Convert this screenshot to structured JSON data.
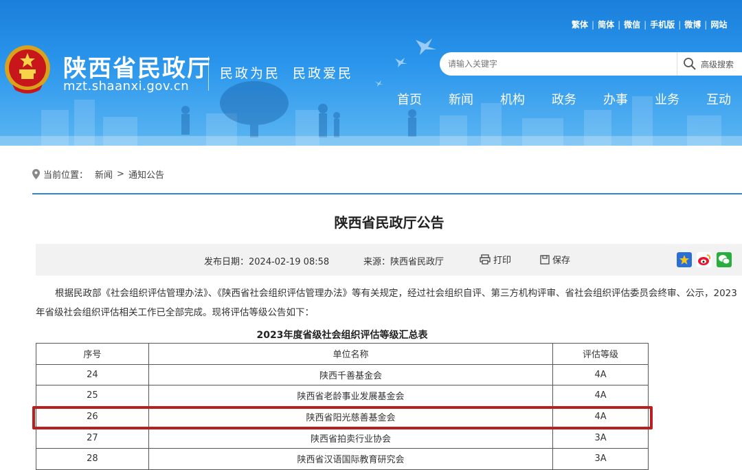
{
  "header": {
    "top_links": [
      "繁体",
      "简体",
      "微信",
      "手机版",
      "微博",
      "网站"
    ],
    "site_title": "陕西省民政厅",
    "site_url": "mzt.shaanxi.gov.cn",
    "slogan": [
      "民政为民",
      "民政爱民"
    ],
    "search_placeholder": "请输入关键字",
    "search_advanced": "高级搜索",
    "nav": [
      "首页",
      "新闻",
      "机构",
      "政务",
      "办事",
      "业务",
      "互动"
    ]
  },
  "breadcrumb": {
    "label": "当前位置：",
    "items": [
      "新闻",
      "通知公告"
    ],
    "separator": ">"
  },
  "article": {
    "title": "陕西省民政厅公告",
    "date": "发布日期：2024-02-19 08:58",
    "source": "来源：陕西省民政厅",
    "print": "打印",
    "save": "保存",
    "body": "根据民政部《社会组织评估管理办法》、《陕西省社会组织评估管理办法》等有关规定，经过社会组织自评、第三方机构评审、省社会组织评估委员会终审、公示，2023年省级社会组织评估相关工作已全部完成。现将评估等级公告如下：",
    "table_title": "2023年度省级社会组织评估等级汇总表",
    "columns": [
      "序号",
      "单位名称",
      "评估等级"
    ],
    "rows": [
      [
        "24",
        "陕西千善基金会",
        "4A"
      ],
      [
        "25",
        "陕西省老龄事业发展基金会",
        "4A"
      ],
      [
        "26",
        "陕西省阳光慈善基金会",
        "4A"
      ],
      [
        "27",
        "陕西省拍卖行业协会",
        "3A"
      ],
      [
        "28",
        "陕西省汉语国际教育研究会",
        "3A"
      ]
    ]
  },
  "colors": {
    "header_blue": "#1a7fdb",
    "rule_blue": "#2f86d6",
    "highlight_red": "#b81f1f"
  }
}
